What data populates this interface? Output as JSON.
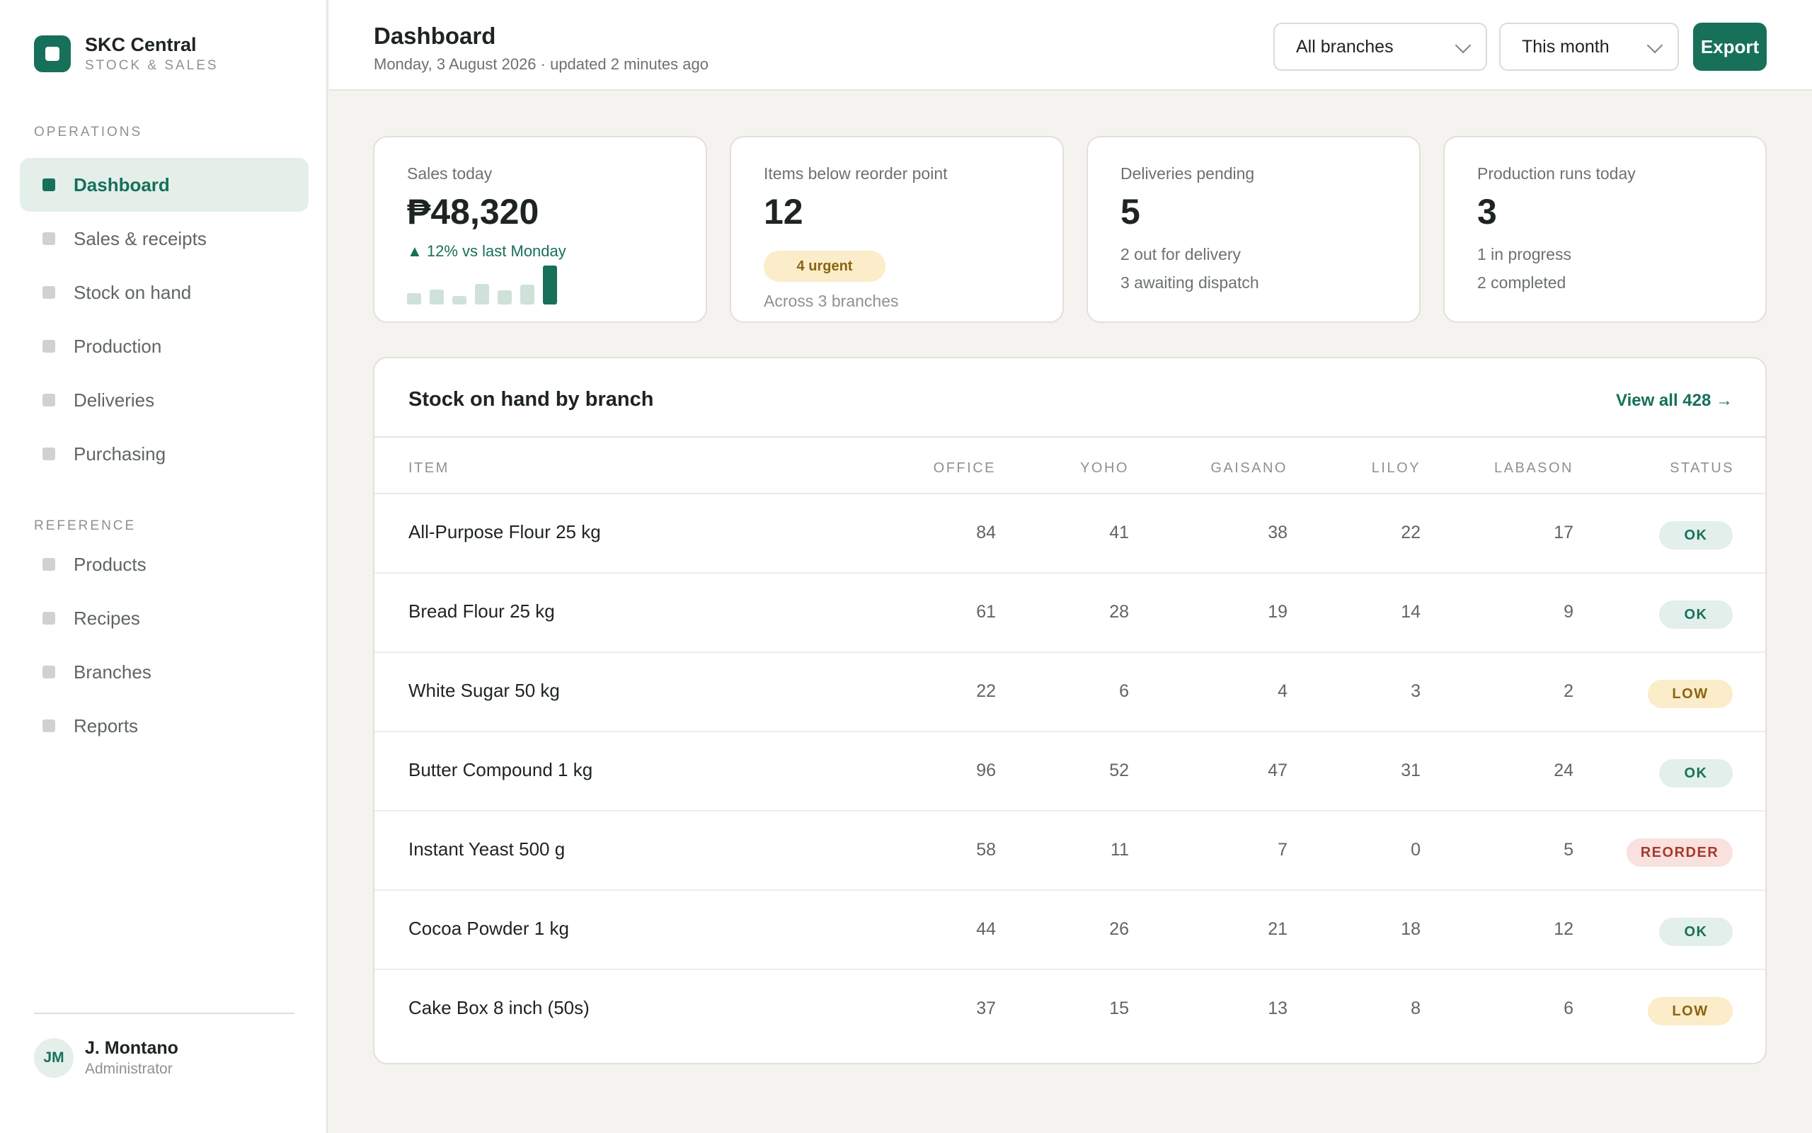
{
  "brand": {
    "name": "SKC Central",
    "subtitle": "STOCK & SALES"
  },
  "sidebar": {
    "operations_label": "OPERATIONS",
    "operations": [
      {
        "label": "Dashboard",
        "active": true
      },
      {
        "label": "Sales & receipts"
      },
      {
        "label": "Stock on hand"
      },
      {
        "label": "Production"
      },
      {
        "label": "Deliveries"
      },
      {
        "label": "Purchasing"
      }
    ],
    "reference_label": "REFERENCE",
    "reference": [
      {
        "label": "Products"
      },
      {
        "label": "Recipes"
      },
      {
        "label": "Branches"
      },
      {
        "label": "Reports"
      }
    ]
  },
  "user": {
    "initials": "JM",
    "name": "J. Montano",
    "role": "Administrator"
  },
  "header": {
    "title": "Dashboard",
    "subtitle": "Monday, 3 August 2026 · updated 2 minutes ago",
    "branch_select": "All branches",
    "period_select": "This month",
    "export_label": "Export"
  },
  "cards": {
    "sales": {
      "label": "Sales today",
      "value": "₱48,320",
      "trend": "▲ 12% vs last Monday",
      "spark": [
        0.28,
        0.38,
        0.22,
        0.52,
        0.36,
        0.5,
        0.98
      ]
    },
    "reorder": {
      "label": "Items below reorder point",
      "value": "12",
      "badge": "4 urgent",
      "note": "Across 3 branches"
    },
    "deliveries": {
      "label": "Deliveries pending",
      "value": "5",
      "line1": "2 out for delivery",
      "line2": "3 awaiting dispatch"
    },
    "production": {
      "label": "Production runs today",
      "value": "3",
      "line1": "1 in progress",
      "line2": "2 completed"
    }
  },
  "stock": {
    "title": "Stock on hand by branch",
    "view_all": "View all 428 →",
    "columns": [
      "ITEM",
      "OFFICE",
      "YOHO",
      "GAISANO",
      "LILOY",
      "LABASON",
      "STATUS"
    ],
    "rows": [
      {
        "item": "All-Purpose Flour 25 kg",
        "office": "84",
        "yoho": "41",
        "gaisano": "38",
        "liloy": "22",
        "labason": "17",
        "status": "OK",
        "kind": "ok"
      },
      {
        "item": "Bread Flour 25 kg",
        "office": "61",
        "yoho": "28",
        "gaisano": "19",
        "liloy": "14",
        "labason": "9",
        "status": "OK",
        "kind": "ok"
      },
      {
        "item": "White Sugar 50 kg",
        "office": "22",
        "yoho": "6",
        "gaisano": "4",
        "liloy": "3",
        "labason": "2",
        "status": "LOW",
        "kind": "low"
      },
      {
        "item": "Butter Compound 1 kg",
        "office": "96",
        "yoho": "52",
        "gaisano": "47",
        "liloy": "31",
        "labason": "24",
        "status": "OK",
        "kind": "ok"
      },
      {
        "item": "Instant Yeast 500 g",
        "office": "58",
        "yoho": "11",
        "gaisano": "7",
        "liloy": "0",
        "labason": "5",
        "status": "REORDER",
        "kind": "reorder"
      },
      {
        "item": "Cocoa Powder 1 kg",
        "office": "44",
        "yoho": "26",
        "gaisano": "21",
        "liloy": "18",
        "labason": "12",
        "status": "OK",
        "kind": "ok"
      },
      {
        "item": "Cake Box 8 inch (50s)",
        "office": "37",
        "yoho": "15",
        "gaisano": "13",
        "liloy": "8",
        "labason": "6",
        "status": "LOW",
        "kind": "low"
      }
    ]
  }
}
